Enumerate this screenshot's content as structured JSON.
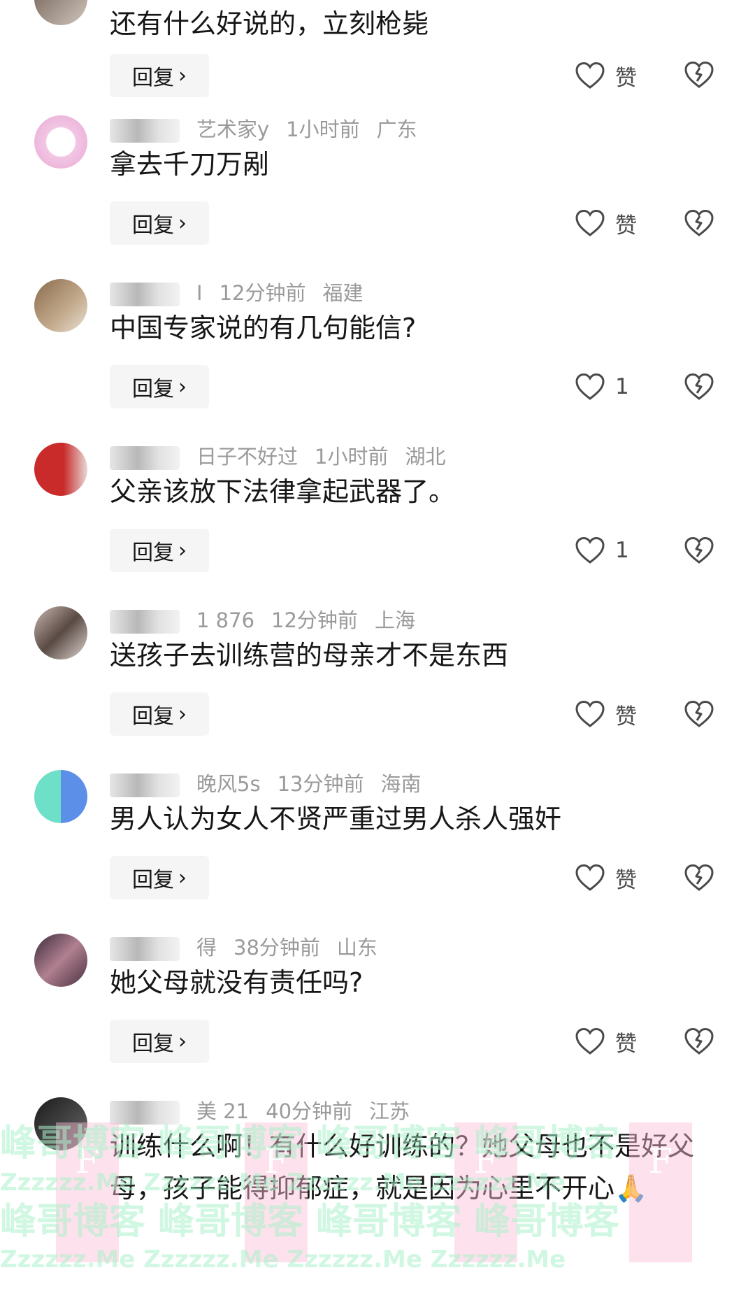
{
  "comments": [
    {
      "author": "",
      "time": "",
      "region": "",
      "text": "还有什么好说的，立刻枪毙",
      "reply_label": "回复",
      "like_label": "赞"
    },
    {
      "author": "艺术家y",
      "time": "1小时前",
      "region": "广东",
      "text": "拿去千刀万剐",
      "reply_label": "回复",
      "like_label": "赞"
    },
    {
      "author": "I",
      "time": "12分钟前",
      "region": "福建",
      "text": "中国专家说的有几句能信?",
      "reply_label": "回复",
      "like_label": "1"
    },
    {
      "author": "日子不好过",
      "time": "1小时前",
      "region": "湖北",
      "text": "父亲该放下法律拿起武器了。",
      "reply_label": "回复",
      "like_label": "1"
    },
    {
      "author": "1 876",
      "time": "12分钟前",
      "region": "上海",
      "text": "送孩子去训练营的母亲才不是东西",
      "reply_label": "回复",
      "like_label": "赞"
    },
    {
      "author": "晚风5s",
      "time": "13分钟前",
      "region": "海南",
      "text": "男人认为女人不贤严重过男人杀人强奸",
      "reply_label": "回复",
      "like_label": "赞"
    },
    {
      "author": "得",
      "time": "38分钟前",
      "region": "山东",
      "text": "她父母就没有责任吗?",
      "reply_label": "回复",
      "like_label": "赞"
    },
    {
      "author": "美 21",
      "time": "40分钟前",
      "region": "江苏",
      "text": "训练什么啊！有什么好训练的？她父母也不是好父母，孩子能得抑郁症，就是因为心里不开心🙏",
      "reply_label": "",
      "like_label": ""
    }
  ],
  "watermark": {
    "line1": "峰哥博客  峰哥博客  峰哥博客  峰哥博客",
    "line2": "Zzzzzz.Me   Zzzzzz.Me   Zzzzzz.Me   Zzzzzz.Me",
    "tile_letter": "F"
  },
  "colors": {
    "text": "#161616",
    "meta": "#9a9a9a",
    "reply_bg": "#f5f5f5",
    "icon": "#4a4a4a"
  },
  "icons": [
    "heart-outline-icon",
    "broken-heart-icon",
    "chevron-right-icon"
  ]
}
